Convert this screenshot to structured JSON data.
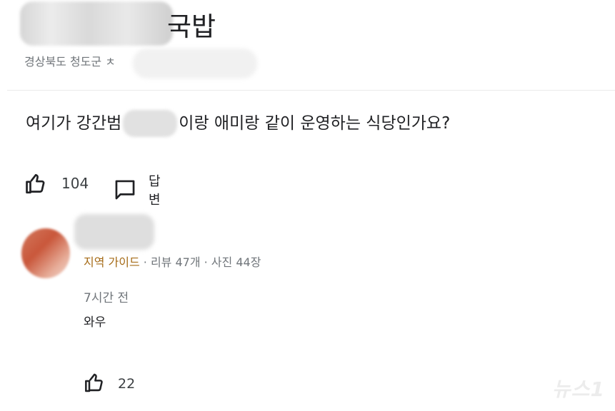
{
  "place": {
    "title_visible": "국밥",
    "subtitle_visible": "경상북도 청도군 ㅊ"
  },
  "question": {
    "text_before": "여기가 강간범 ",
    "text_after": "이랑 애미랑 같이 운영하는 식당인가요?",
    "like_count": "104",
    "reply_label": "답변"
  },
  "comment": {
    "guide_badge": "지역 가이드",
    "stats": " · 리뷰 47개 · 사진 44장",
    "time": "7시간 전",
    "text": "와우",
    "like_count": "22"
  },
  "watermark": {
    "text": "뉴스1"
  },
  "icons": {
    "like": "thumbs-up-icon",
    "reply": "comment-bubble-icon"
  },
  "colors": {
    "guide_badge": "#a56b17",
    "secondary_text": "#70757a",
    "primary_text": "#202124"
  }
}
